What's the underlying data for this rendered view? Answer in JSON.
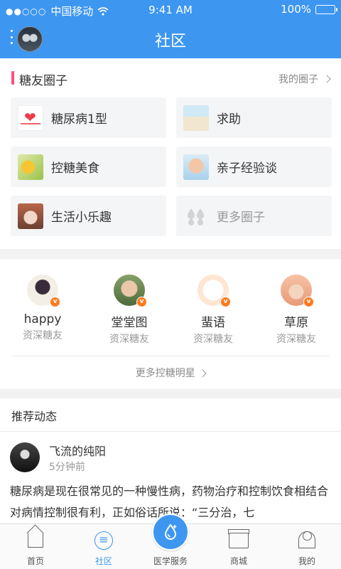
{
  "status_bar": {
    "signal": "●●○○○",
    "carrier": "中国移动",
    "time": "9:41 AM",
    "battery": "100%"
  },
  "header": {
    "title": "社区"
  },
  "circles": {
    "title": "糖友圈子",
    "more_label": "我的圈子",
    "items": [
      {
        "label": "糖尿病1型",
        "icon": "heart-thumb"
      },
      {
        "label": "求助",
        "icon": "help-thumb"
      },
      {
        "label": "控糖美食",
        "icon": "food-thumb"
      },
      {
        "label": "亲子经验谈",
        "icon": "baby-thumb"
      },
      {
        "label": "生活小乐趣",
        "icon": "cat-thumb"
      },
      {
        "label": "更多圈子",
        "icon": "drops-icon"
      }
    ]
  },
  "stars": {
    "items": [
      {
        "name": "happy",
        "role": "资深糖友",
        "badge": "v"
      },
      {
        "name": "堂堂图",
        "role": "资深糖友",
        "badge": "v"
      },
      {
        "name": "蜚语",
        "role": "资深糖友",
        "badge": "v"
      },
      {
        "name": "草原",
        "role": "资深糖友",
        "badge": "v"
      }
    ],
    "more_label": "更多控糖明星"
  },
  "feed": {
    "title": "推荐动态",
    "post": {
      "user": "飞流的纯阳",
      "time": "5分钟前",
      "body": "糖尿病是现在很常见的一种慢性病，药物治疗和控制饮食相结合对病情控制很有利，正如俗话所说：“三分治，七"
    }
  },
  "tabbar": {
    "items": [
      {
        "label": "首页"
      },
      {
        "label": "社区",
        "active": true
      },
      {
        "label": "医学服务"
      },
      {
        "label": "商城"
      },
      {
        "label": "我的"
      }
    ]
  },
  "colors": {
    "primary": "#3d96f0",
    "accent_bar": "#ff4f7a",
    "badge": "#ff7a1f"
  }
}
